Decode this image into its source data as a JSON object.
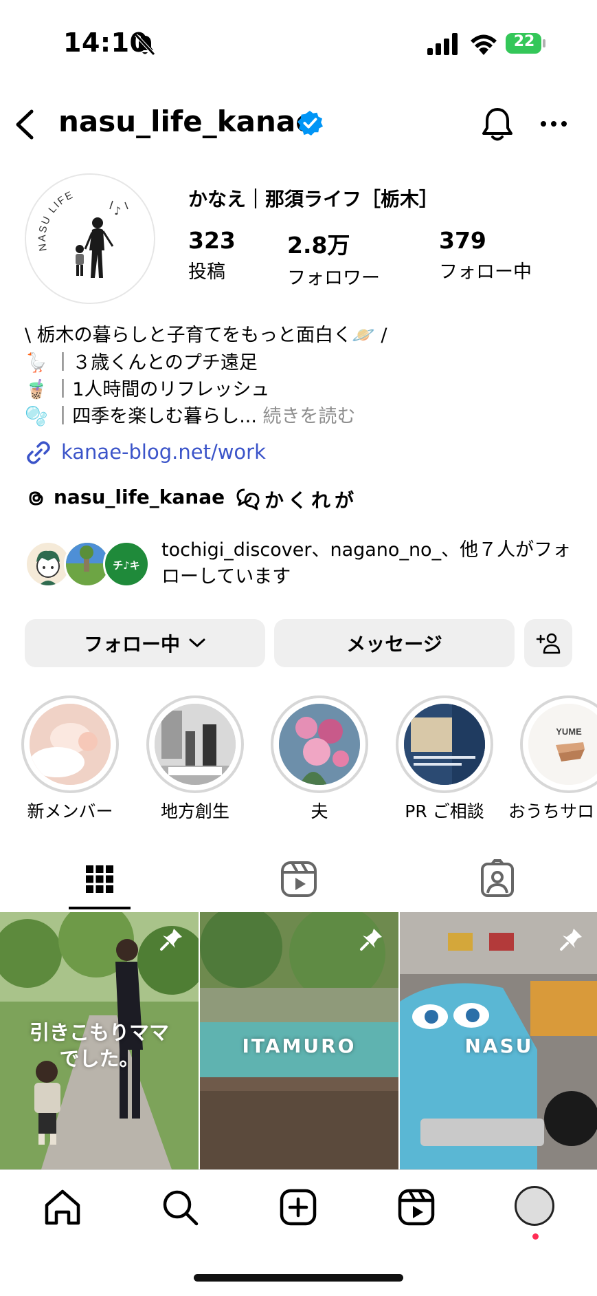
{
  "status_bar": {
    "time": "14:10",
    "battery": "22"
  },
  "header": {
    "username": "nasu_life_kanae"
  },
  "profile": {
    "avatar_text": "NASU LIFE",
    "display_name": "かなえ｜那須ライフ［栃木］",
    "stats": [
      {
        "value": "323",
        "label": "投稿"
      },
      {
        "value": "2.8万",
        "label": "フォロワー"
      },
      {
        "value": "379",
        "label": "フォロー中"
      }
    ],
    "bio": [
      "\\ 栃木の暮らしと子育てをもっと面白く🪐 /",
      "🪿 ｜３歳くんとのプチ遠足",
      "🧋 ｜1人時間のリフレッシュ",
      "🫧 ｜四季を楽しむ暮らし..."
    ],
    "bio_more": "続きを読む",
    "link": "kanae-blog.net/work",
    "threads_handle": "nasu_life_kanae",
    "channel": "かくれが",
    "followed_by": "tochigi_discover、nagano_no_、他７人がフォローしています",
    "fav_badge_text": "チ♪キ"
  },
  "buttons": {
    "following": "フォロー中",
    "message": "メッセージ"
  },
  "highlights": [
    {
      "label": "新メンバー"
    },
    {
      "label": "地方創生"
    },
    {
      "label": "夫"
    },
    {
      "label": "PR ご相談"
    },
    {
      "label": "おうちサロ",
      "cover_text": "YUME"
    }
  ],
  "posts": [
    {
      "caption": "引きこもりママ\nでした。",
      "pinned": true
    },
    {
      "caption": "ITAMURO",
      "pinned": true
    },
    {
      "caption": "NASU",
      "pinned": true
    }
  ],
  "colors": {
    "verified": "#0095f6",
    "link": "#3b54c9",
    "button_bg": "#efefef",
    "battery": "#34c759",
    "notify": "#ff2d55"
  }
}
